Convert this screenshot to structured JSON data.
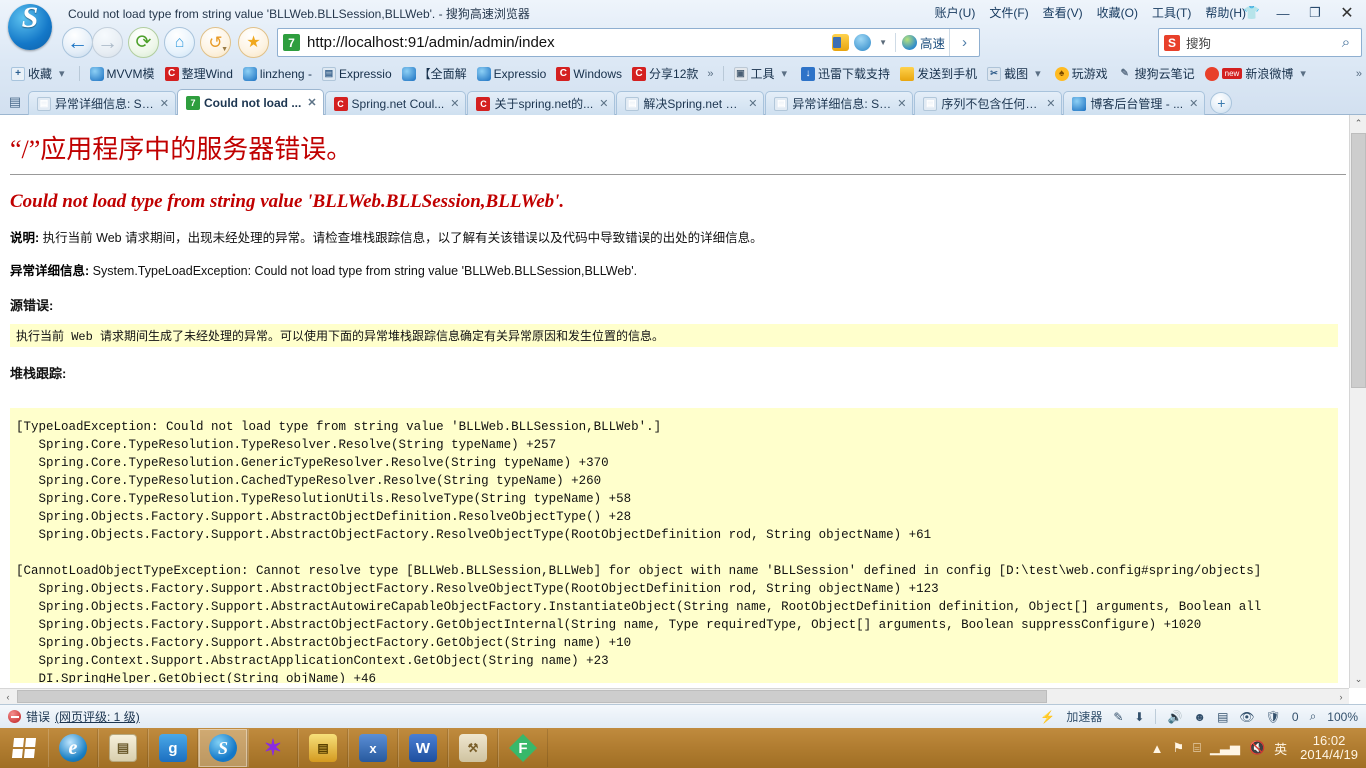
{
  "window": {
    "title": "Could not load type from string value 'BLLWeb.BLLSession,BLLWeb'. - 搜狗高速浏览器",
    "logo_letter": "S",
    "menus": [
      "账户(U)",
      "文件(F)",
      "查看(V)",
      "收藏(O)",
      "工具(T)",
      "帮助(H)"
    ],
    "minimize": "—",
    "maximize": "❐",
    "close": "✕"
  },
  "nav": {
    "back": "←",
    "forward": "→",
    "reload": "⟳",
    "home": "⌂",
    "undo": "↺",
    "favorite": "★"
  },
  "address": {
    "badge": "7",
    "url": "http://localhost:91/admin/admin/index",
    "speed_label": "高速",
    "go": "›"
  },
  "search": {
    "engine_letter": "S",
    "value": "搜狗",
    "magnifier": "🔍"
  },
  "bookmarks": [
    {
      "label": "收藏",
      "icon": "star-folder-icon",
      "style": "ic-fav",
      "glyph": "+",
      "caret": true
    },
    {
      "label": "MVVM模",
      "icon": "sogou-icon",
      "style": "ic-blue",
      "glyph": ""
    },
    {
      "label": "整理Wind",
      "icon": "csdn-icon",
      "style": "ic-red",
      "glyph": "C"
    },
    {
      "label": "linzheng -",
      "icon": "sogou-icon",
      "style": "ic-blue",
      "glyph": ""
    },
    {
      "label": "Expressio",
      "icon": "page-icon",
      "style": "ic-page",
      "glyph": "▤"
    },
    {
      "label": "【全面解",
      "icon": "sogou-icon",
      "style": "ic-blue",
      "glyph": ""
    },
    {
      "label": "Expressio",
      "icon": "sogou-icon",
      "style": "ic-blue",
      "glyph": ""
    },
    {
      "label": "Windows",
      "icon": "csdn-icon",
      "style": "ic-red",
      "glyph": "C"
    },
    {
      "label": "分享12款",
      "icon": "csdn-icon",
      "style": "ic-red",
      "glyph": "C"
    }
  ],
  "bookmarks_right": [
    {
      "label": "工具",
      "icon": "tools-icon",
      "style": "ic-gray",
      "glyph": "▣",
      "caret": true
    },
    {
      "label": "迅雷下载支持",
      "icon": "thunder-download-icon",
      "style": "ic-dl",
      "glyph": "↓"
    },
    {
      "label": "发送到手机",
      "icon": "send-to-phone-icon",
      "style": "ic-phone",
      "glyph": ""
    },
    {
      "label": "截图",
      "icon": "screenshot-icon",
      "style": "ic-shot",
      "glyph": "✂",
      "caret": true
    },
    {
      "label": "玩游戏",
      "icon": "game-icon",
      "style": "ic-game",
      "glyph": "♠"
    },
    {
      "label": "搜狗云笔记",
      "icon": "cloud-note-icon",
      "style": "ic-note",
      "glyph": "✎"
    },
    {
      "label": "新浪微博",
      "icon": "weibo-icon",
      "style": "ic-weibo",
      "glyph": "",
      "badge": "new",
      "caret": true
    }
  ],
  "bookmark_overflow": "»",
  "tabs": [
    {
      "label": "异常详细信息: Sy...",
      "icon": "page-favicon",
      "style": "fv-page",
      "glyph": "▤",
      "active": false
    },
    {
      "label": "Could not load ...",
      "icon": "aspnet-favicon",
      "style": "fv-green",
      "glyph": "7",
      "active": true
    },
    {
      "label": "Spring.net Coul...",
      "icon": "csdn-favicon",
      "style": "fv-red",
      "glyph": "C",
      "active": false
    },
    {
      "label": "关于spring.net的...",
      "icon": "csdn-favicon",
      "style": "fv-red",
      "glyph": "C",
      "active": false
    },
    {
      "label": "解决Spring.net C...",
      "icon": "page-favicon",
      "style": "fv-page",
      "glyph": "▤",
      "active": false
    },
    {
      "label": "异常详细信息: Sy...",
      "icon": "page-favicon",
      "style": "fv-page",
      "glyph": "▤",
      "active": false
    },
    {
      "label": "序列不包含任何元...",
      "icon": "page-favicon",
      "style": "fv-page",
      "glyph": "▤",
      "active": false
    },
    {
      "label": "博客后台管理 - ...",
      "icon": "sogou-favicon",
      "style": "fv-blue",
      "glyph": "",
      "active": false
    }
  ],
  "tab_close_glyph": "✕",
  "new_tab_glyph": "+",
  "page": {
    "heading": "“/”应用程序中的服务器错误。",
    "subheading": "Could not load type from string value 'BLLWeb.BLLSession,BLLWeb'.",
    "description_label": "说明:",
    "description_text": "执行当前 Web 请求期间，出现未经处理的异常。请检查堆栈跟踪信息，以了解有关该错误以及代码中导致错误的出处的详细信息。",
    "exception_label": "异常详细信息:",
    "exception_text": "System.TypeLoadException: Could not load type from string value 'BLLWeb.BLLSession,BLLWeb'.",
    "source_error_label": "源错误:",
    "source_error_text": "执行当前 Web 请求期间生成了未经处理的异常。可以使用下面的异常堆栈跟踪信息确定有关异常原因和发生位置的信息。",
    "stack_trace_label": "堆栈跟踪:",
    "stack_trace": [
      "[TypeLoadException: Could not load type from string value 'BLLWeb.BLLSession,BLLWeb'.]",
      "   Spring.Core.TypeResolution.TypeResolver.Resolve(String typeName) +257",
      "   Spring.Core.TypeResolution.GenericTypeResolver.Resolve(String typeName) +370",
      "   Spring.Core.TypeResolution.CachedTypeResolver.Resolve(String typeName) +260",
      "   Spring.Core.TypeResolution.TypeResolutionUtils.ResolveType(String typeName) +58",
      "   Spring.Objects.Factory.Support.AbstractObjectDefinition.ResolveObjectType() +28",
      "   Spring.Objects.Factory.Support.AbstractObjectFactory.ResolveObjectType(RootObjectDefinition rod, String objectName) +61",
      "",
      "[CannotLoadObjectTypeException: Cannot resolve type [BLLWeb.BLLSession,BLLWeb] for object with name 'BLLSession' defined in config [D:\\test\\web.config#spring/objects]",
      "   Spring.Objects.Factory.Support.AbstractObjectFactory.ResolveObjectType(RootObjectDefinition rod, String objectName) +123",
      "   Spring.Objects.Factory.Support.AbstractAutowireCapableObjectFactory.InstantiateObject(String name, RootObjectDefinition definition, Object[] arguments, Boolean all",
      "   Spring.Objects.Factory.Support.AbstractObjectFactory.GetObjectInternal(String name, Type requiredType, Object[] arguments, Boolean suppressConfigure) +1020",
      "   Spring.Objects.Factory.Support.AbstractObjectFactory.GetObject(String name) +10",
      "   Spring.Context.Support.AbstractApplicationContext.GetObject(String name) +23",
      "   DI.SpringHelper.GetObject(String objName) +46"
    ]
  },
  "scrollbars": {
    "up_arrow": "⌃",
    "down_arrow": "⌄",
    "left_arrow": "‹",
    "right_arrow": "›"
  },
  "status": {
    "error_text": "错误",
    "rating_link": "(网页评级: 1 级)",
    "accelerator": "加速器",
    "blocked_count": "0",
    "zoom": "100%"
  },
  "taskbar": {
    "start_label": "start",
    "items": [
      {
        "name": "internet-explorer",
        "style": "tbi-ie",
        "glyph": "e",
        "active": false
      },
      {
        "name": "file-manager",
        "style": "tbi-fm",
        "glyph": "▤",
        "active": false
      },
      {
        "name": "qq-messenger",
        "style": "tbi-g",
        "glyph": "g",
        "active": false
      },
      {
        "name": "sogou-browser",
        "style": "tbi-s",
        "glyph": "S",
        "active": true
      },
      {
        "name": "visual-studio",
        "style": "tbi-vs",
        "glyph": "✶",
        "active": false
      },
      {
        "name": "zip-archiver",
        "style": "tbi-z",
        "glyph": "▤",
        "active": false
      },
      {
        "name": "excel-xf-tool",
        "style": "tbi-xl",
        "glyph": "x",
        "active": false
      },
      {
        "name": "word",
        "style": "tbi-w",
        "glyph": "W",
        "active": false
      },
      {
        "name": "dev-tool",
        "style": "tbi-t",
        "glyph": "⚒",
        "active": false
      },
      {
        "name": "foxmail",
        "style": "tbi-f",
        "glyph": "F",
        "active": false
      }
    ],
    "tray_expand": "▲",
    "flag": "⚑",
    "ime": "英",
    "time": "16:02",
    "date": "2014/4/19"
  }
}
